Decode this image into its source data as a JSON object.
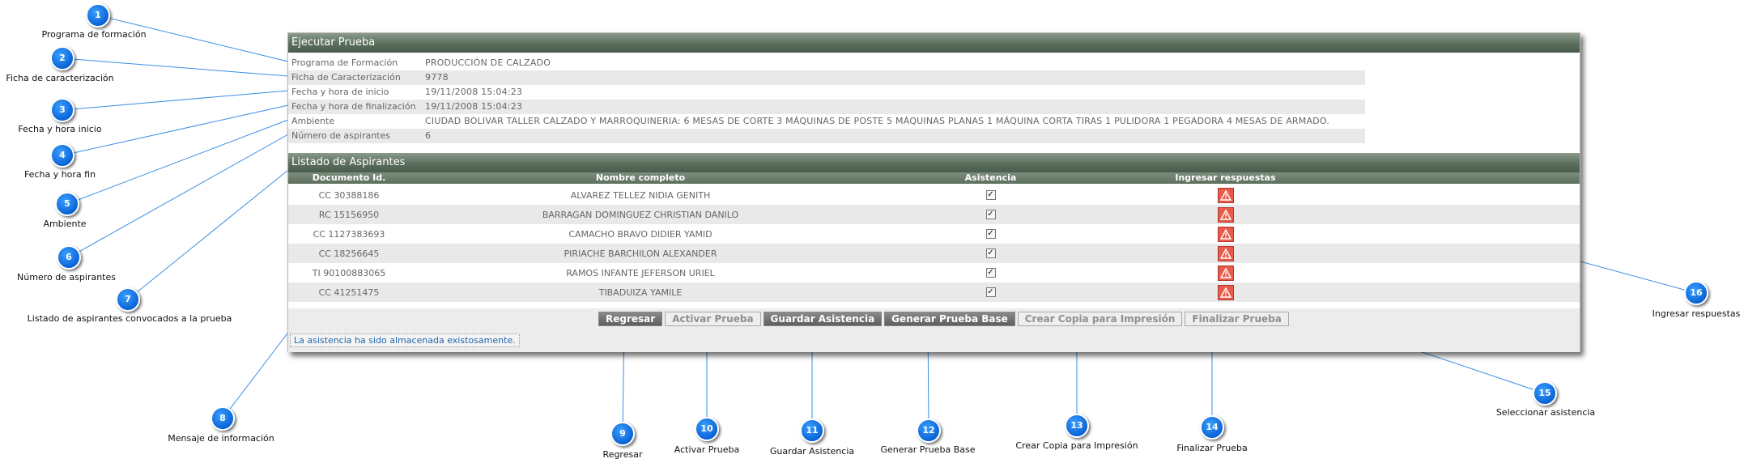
{
  "window": {
    "title": "Ejecutar Prueba",
    "info": [
      {
        "label": "Programa de Formación",
        "value": "PRODUCCIÓN DE CALZADO"
      },
      {
        "label": "Ficha de Caracterización",
        "value": "9778"
      },
      {
        "label": "Fecha y hora de inicio",
        "value": "19/11/2008 15:04:23"
      },
      {
        "label": "Fecha y hora de finalización",
        "value": "19/11/2008 15:04:23"
      },
      {
        "label": "Ambiente",
        "value": "CIUDAD BOLIVAR TALLER CALZADO Y MARROQUINERIA: 6 MESAS DE CORTE 3 MÁQUINAS DE POSTE 5 MÁQUINAS PLANAS 1 MÁQUINA CORTA TIRAS 1 PULIDORA 1 PEGADORA 4 MESAS DE ARMADO."
      },
      {
        "label": "Número de aspirantes",
        "value": "6"
      }
    ],
    "list_title": "Listado de Aspirantes",
    "columns": [
      "Documento Id.",
      "Nombre completo",
      "Asistencia",
      "Ingresar respuestas"
    ],
    "rows": [
      {
        "doc": "CC 30388186",
        "name": "ALVAREZ TELLEZ NIDIA GENITH",
        "checked": true
      },
      {
        "doc": "RC 15156950",
        "name": "BARRAGAN DOMINGUEZ CHRISTIAN DANILO",
        "checked": true
      },
      {
        "doc": "CC 1127383693",
        "name": "CAMACHO BRAVO DIDIER YAMID",
        "checked": true
      },
      {
        "doc": "CC 18256645",
        "name": "PIRIACHE BARCHILON ALEXANDER",
        "checked": true
      },
      {
        "doc": "TI 90100883065",
        "name": "RAMOS INFANTE JEFERSON URIEL",
        "checked": true
      },
      {
        "doc": "CC 41251475",
        "name": "TIBADUIZA YAMILE",
        "checked": true
      }
    ],
    "buttons": [
      {
        "label": "Regresar",
        "enabled": true
      },
      {
        "label": "Activar Prueba",
        "enabled": false
      },
      {
        "label": "Guardar Asistencia",
        "enabled": true
      },
      {
        "label": "Generar Prueba Base",
        "enabled": true
      },
      {
        "label": "Crear Copia para Impresión",
        "enabled": false
      },
      {
        "label": "Finalizar Prueba",
        "enabled": false
      }
    ],
    "message": "La asistencia ha sido almacenada existosamente."
  },
  "callouts": [
    {
      "n": "1",
      "label": "Programa de formación"
    },
    {
      "n": "2",
      "label": "Ficha de caracterización"
    },
    {
      "n": "3",
      "label": "Fecha y hora inicio"
    },
    {
      "n": "4",
      "label": "Fecha y hora fin"
    },
    {
      "n": "5",
      "label": "Ambiente"
    },
    {
      "n": "6",
      "label": "Número de aspirantes"
    },
    {
      "n": "7",
      "label": "Listado de aspirantes convocados a la prueba"
    },
    {
      "n": "8",
      "label": "Mensaje de información"
    },
    {
      "n": "9",
      "label": "Regresar"
    },
    {
      "n": "10",
      "label": "Activar Prueba"
    },
    {
      "n": "11",
      "label": "Guardar Asistencia"
    },
    {
      "n": "12",
      "label": "Generar Prueba Base"
    },
    {
      "n": "13",
      "label": "Crear Copia para Impresión"
    },
    {
      "n": "14",
      "label": "Finalizar Prueba"
    },
    {
      "n": "15",
      "label": "Seleccionar asistencia"
    },
    {
      "n": "16",
      "label": "Ingresar respuestas"
    }
  ],
  "colors": {
    "header_bar": "#5a6e5c",
    "badge": "#0a63d6",
    "warning_icon": "#e85a4a",
    "leader_line": "#3a8ee6",
    "message_text": "#2266aa"
  },
  "icons": {
    "attendance": "checkbox-checked-icon",
    "answers": "warning-triangle-icon"
  }
}
